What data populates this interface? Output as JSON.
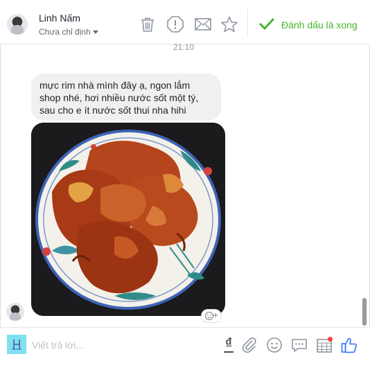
{
  "header": {
    "contact_name": "Linh Nấm",
    "assign_label": "Chưa chỉ định",
    "done_label": "Đánh dấu là xong",
    "icons": [
      "trash-icon",
      "spam-alert-icon",
      "envelope-icon",
      "star-icon",
      "checkmark-icon"
    ]
  },
  "conversation": {
    "timestamp": "21:10",
    "message_lines": [
      "mực rim nhà mình đây ạ, ngon lắm",
      "shop nhé, hơi nhiều nước sốt một tý,",
      "sau cho e ít nước sốt thui nha hihi"
    ],
    "photo": "photo of braised squid in sauce on a decorated plate"
  },
  "composer": {
    "placeholder": "Viết trả lời...",
    "currency_symbol": "₫",
    "icons": [
      "currency-icon",
      "attachment-icon",
      "emoji-icon",
      "saved-reply-icon",
      "appointment-icon",
      "like-icon"
    ]
  },
  "colors": {
    "accent_green": "#42b72a",
    "like_blue": "#4080ff",
    "notification_red": "#fa3e3e",
    "bubble_gray": "#f1f0f0"
  }
}
